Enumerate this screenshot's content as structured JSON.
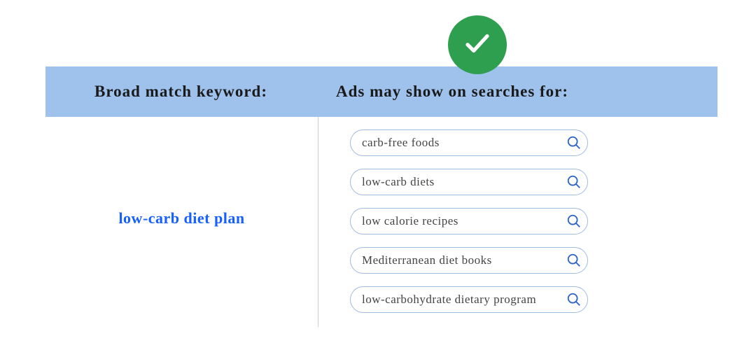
{
  "header": {
    "left": "Broad match keyword:",
    "right": "Ads may show on searches for:"
  },
  "keyword": "low-carb diet plan",
  "searches": [
    "carb-free foods",
    "low-carb diets",
    "low calorie recipes",
    "Mediterranean diet books",
    "low-carbohydrate dietary program"
  ],
  "colors": {
    "header_bg": "#9fc2ed",
    "badge_bg": "#2e9e4f",
    "keyword_text": "#1560ff",
    "pill_border": "#9fbce2",
    "mag_stroke": "#2a62c9"
  }
}
